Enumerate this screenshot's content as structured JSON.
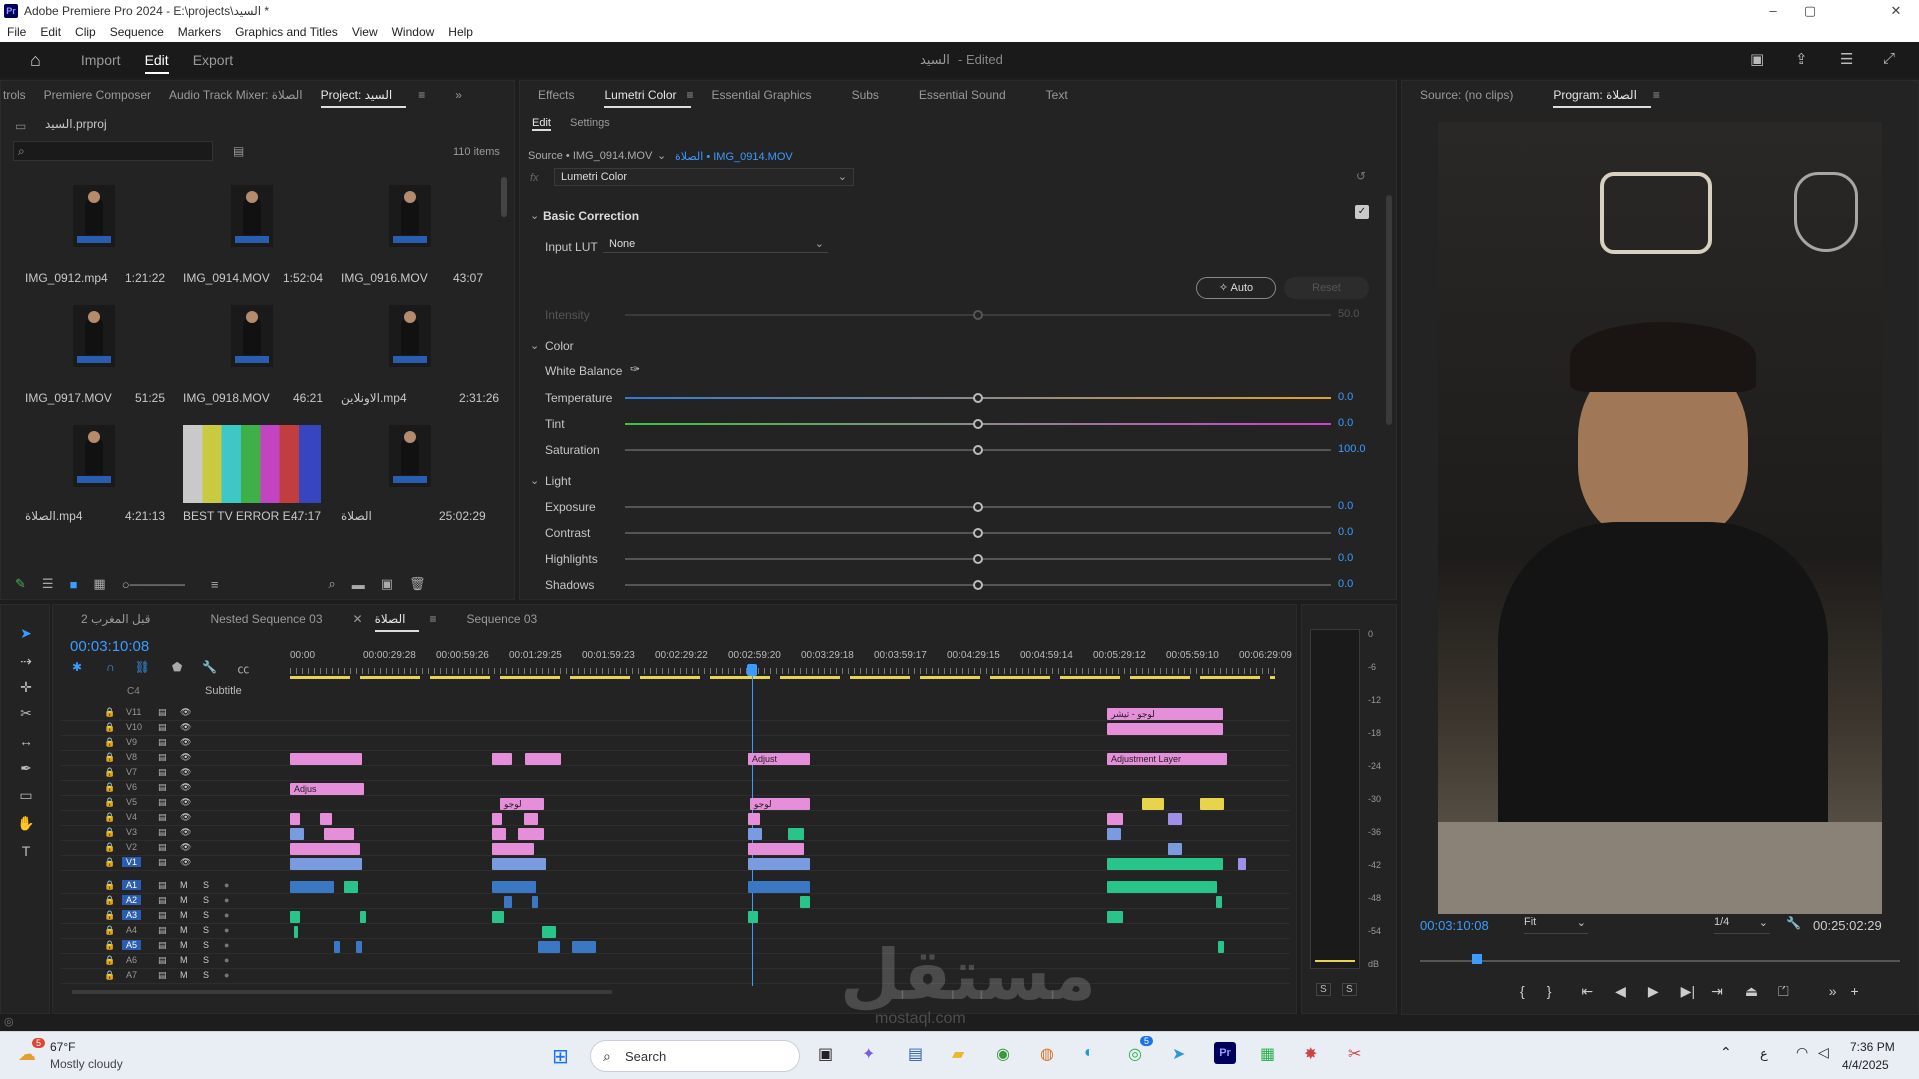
{
  "window": {
    "title": "Adobe Premiere Pro 2024 - E:\\projects\\السيد *",
    "minimize": "–",
    "maximize": "▢",
    "close": "✕"
  },
  "menu": [
    "File",
    "Edit",
    "Clip",
    "Sequence",
    "Markers",
    "Graphics and Titles",
    "View",
    "Window",
    "Help"
  ],
  "header": {
    "tabs": [
      "Import",
      "Edit",
      "Export"
    ],
    "active": "Edit",
    "doc_title": "السيد",
    "doc_status": "- Edited"
  },
  "project_panel": {
    "tabs": [
      "trols",
      "Premiere Composer",
      "Audio Track Mixer: الصلاة",
      "Project: السيد"
    ],
    "active_tab": "Project: السيد",
    "file": "السيد.prproj",
    "item_count": "110 items",
    "items": [
      {
        "name": "IMG_0912.mp4",
        "dur": "1:21:22"
      },
      {
        "name": "IMG_0914.MOV",
        "dur": "1:52:04"
      },
      {
        "name": "IMG_0916.MOV",
        "dur": "43:07"
      },
      {
        "name": "IMG_0917.MOV",
        "dur": "51:25"
      },
      {
        "name": "IMG_0918.MOV",
        "dur": "46:21"
      },
      {
        "name": "الاونلاين.mp4",
        "dur": "2:31:26"
      },
      {
        "name": "الصلاة.mp4",
        "dur": "4:21:13"
      },
      {
        "name": "BEST TV ERROR E...",
        "dur": "47:17"
      },
      {
        "name": "الصلاة",
        "dur": "25:02:29"
      }
    ]
  },
  "effects_panel": {
    "tabs": [
      "Effects",
      "Lumetri Color",
      "Essential Graphics",
      "Subs",
      "Essential Sound",
      "Text"
    ],
    "active_tab": "Lumetri Color",
    "subtabs": [
      "Edit",
      "Settings"
    ],
    "source_label": "Source • IMG_0914.MOV",
    "source_link": "الصلاة • IMG_0914.MOV",
    "fx": "fx",
    "effect_name": "Lumetri Color",
    "basic_correction": "Basic Correction",
    "input_lut_label": "Input LUT",
    "input_lut_value": "None",
    "auto": "Auto",
    "reset": "Reset",
    "intensity": {
      "label": "Intensity",
      "value": "50.0"
    },
    "color_section": "Color",
    "white_balance": "White Balance",
    "light_section": "Light",
    "sliders": [
      {
        "label": "Temperature",
        "value": "0.0"
      },
      {
        "label": "Tint",
        "value": "0.0"
      },
      {
        "label": "Saturation",
        "value": "100.0"
      },
      {
        "label": "Exposure",
        "value": "0.0"
      },
      {
        "label": "Contrast",
        "value": "0.0"
      },
      {
        "label": "Highlights",
        "value": "0.0"
      },
      {
        "label": "Shadows",
        "value": "0.0"
      }
    ]
  },
  "monitor": {
    "tabs": [
      "Source: (no clips)",
      "Program: الصلاة"
    ],
    "active_tab": "Program: الصلاة",
    "timecode": "00:03:10:08",
    "fit": "Fit",
    "resolution": "1/4",
    "duration": "00:25:02:29"
  },
  "timeline": {
    "tabs": [
      "قبل المغرب 2",
      "Nested Sequence 03",
      "الصلاة",
      "Sequence 03"
    ],
    "active_tab": "الصلاة",
    "timecode": "00:03:10:08",
    "ruler": [
      "00:00",
      "00:00:29:28",
      "00:00:59:26",
      "00:01:29:25",
      "00:01:59:23",
      "00:02:29:22",
      "00:02:59:20",
      "00:03:29:18",
      "00:03:59:17",
      "00:04:29:15",
      "00:04:59:14",
      "00:05:29:12",
      "00:05:59:10",
      "00:06:29:09"
    ],
    "subtitle": "Subtitle",
    "c4": "C4",
    "video_tracks": [
      "V11",
      "V10",
      "V9",
      "V8",
      "V7",
      "V6",
      "V5",
      "V4",
      "V3",
      "V2",
      "V1"
    ],
    "audio_tracks": [
      "A1",
      "A2",
      "A3",
      "A4",
      "A5",
      "A6",
      "A7"
    ],
    "clip_labels": {
      "adjust1": "Adjust",
      "adjust2": "Adjus",
      "adjlayer": "Adjustment Layer",
      "logo": "لوجو",
      "logo2": "لوجو",
      "top": "لوجو - تيشر"
    },
    "meter": [
      "0",
      "-6",
      "-12",
      "-18",
      "-24",
      "-30",
      "-36",
      "-42",
      "-48",
      "-54",
      "dB"
    ],
    "solo": "S"
  },
  "taskbar": {
    "temp": "67°F",
    "weather": "Mostly cloudy",
    "search": "Search",
    "time": "7:36 PM",
    "date": "4/4/2025",
    "lang": "ع",
    "badge_weather": "5",
    "badge_whatsapp": "5"
  },
  "watermark": {
    "text": "مستقل",
    "sub": "mostaql.com"
  }
}
